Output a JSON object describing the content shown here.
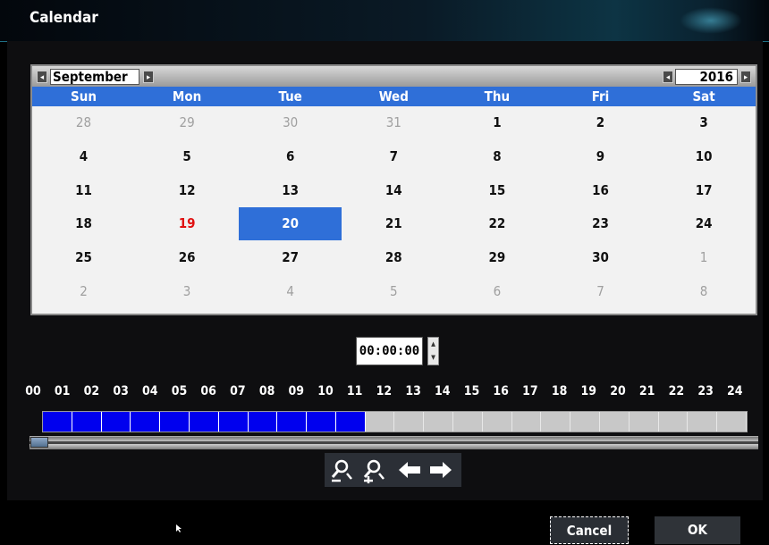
{
  "window": {
    "title": "Calendar"
  },
  "calendar": {
    "month": "September",
    "year": "2016",
    "days_of_week": [
      "Sun",
      "Mon",
      "Tue",
      "Wed",
      "Thu",
      "Fri",
      "Sat"
    ],
    "weeks": [
      [
        "28",
        "29",
        "30",
        "31",
        "1",
        "2",
        "3"
      ],
      [
        "4",
        "5",
        "6",
        "7",
        "8",
        "9",
        "10"
      ],
      [
        "11",
        "12",
        "13",
        "14",
        "15",
        "16",
        "17"
      ],
      [
        "18",
        "19",
        "20",
        "21",
        "22",
        "23",
        "24"
      ],
      [
        "25",
        "26",
        "27",
        "28",
        "29",
        "30",
        "1"
      ],
      [
        "2",
        "3",
        "4",
        "5",
        "6",
        "7",
        "8"
      ]
    ],
    "today": "19",
    "selected": "20",
    "colors": {
      "header_blue": "#2f6fd8",
      "today_red": "#e01010",
      "other_month_gray": "#a0a0a0"
    }
  },
  "time": {
    "value": "00:00:00"
  },
  "timeline": {
    "hours": [
      "00",
      "01",
      "02",
      "03",
      "04",
      "05",
      "06",
      "07",
      "08",
      "09",
      "10",
      "11",
      "12",
      "13",
      "14",
      "15",
      "16",
      "17",
      "18",
      "19",
      "20",
      "21",
      "22",
      "23",
      "24"
    ],
    "recorded_until_hour": 11,
    "colors": {
      "recorded": "#0000ee",
      "empty": "#c8c8c8"
    },
    "scroll_position": 0.0
  },
  "toolbar": {
    "icons": [
      "zoom-out-icon",
      "zoom-in-icon",
      "arrow-left-icon",
      "arrow-right-icon"
    ]
  },
  "buttons": {
    "cancel": "Cancel",
    "ok": "OK"
  }
}
